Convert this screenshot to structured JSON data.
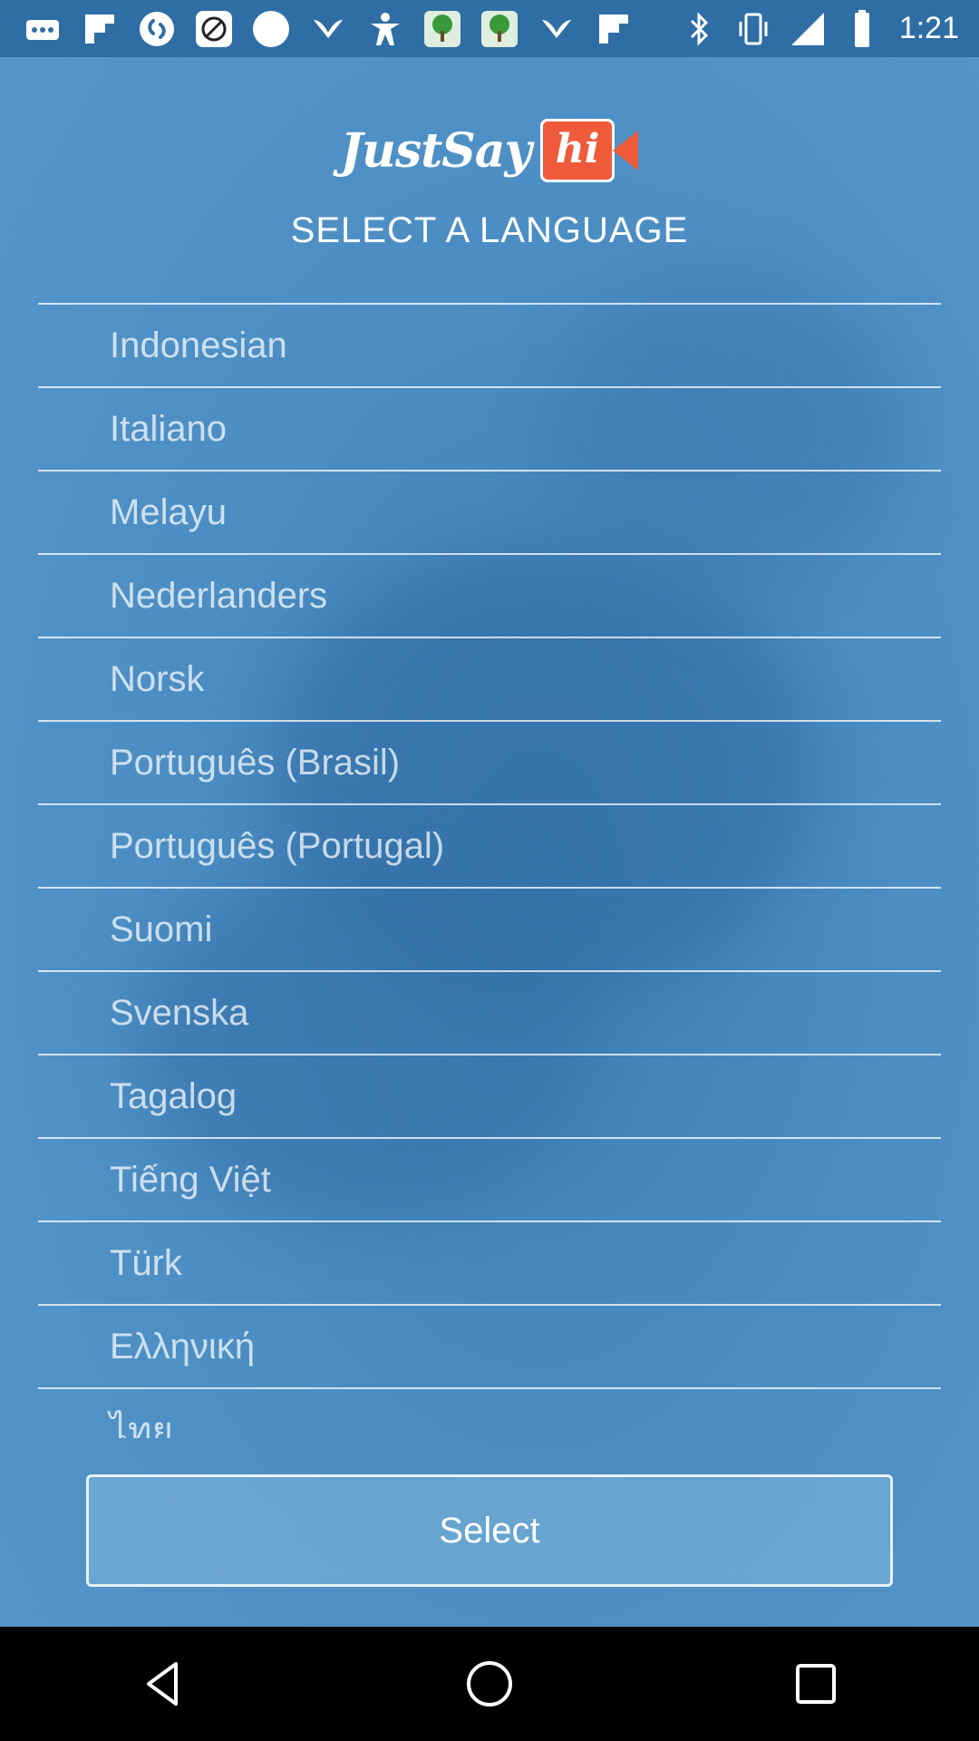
{
  "status_bar": {
    "time": "1:21",
    "icons": [
      "more-icon",
      "flipboard-icon",
      "shazam-icon",
      "blocked-icon",
      "circle-icon",
      "wings-icon",
      "person-icon",
      "tree-app-icon",
      "tree-app-icon",
      "wings-icon",
      "flipboard-icon"
    ],
    "right_icons": [
      "bluetooth-icon",
      "vibrate-icon",
      "signal-icon",
      "battery-icon"
    ]
  },
  "header": {
    "logo_text": "JustSay",
    "logo_hi": "hi",
    "title": "SELECT A LANGUAGE"
  },
  "languages": [
    "Indonesian",
    "Italiano",
    "Melayu",
    "Nederlanders",
    "Norsk",
    "Português (Brasil)",
    "Português (Portugal)",
    "Suomi",
    "Svenska",
    "Tagalog",
    "Tiếng Việt",
    "Türk",
    "Ελληνική",
    "ไทย"
  ],
  "select_button": {
    "label": "Select"
  },
  "nav": {
    "back": "back-icon",
    "home": "home-icon",
    "recents": "recents-icon"
  },
  "colors": {
    "background": "#4b8dc2",
    "status_bar": "#2f6ea4",
    "logo_accent": "#ee5a3a"
  }
}
